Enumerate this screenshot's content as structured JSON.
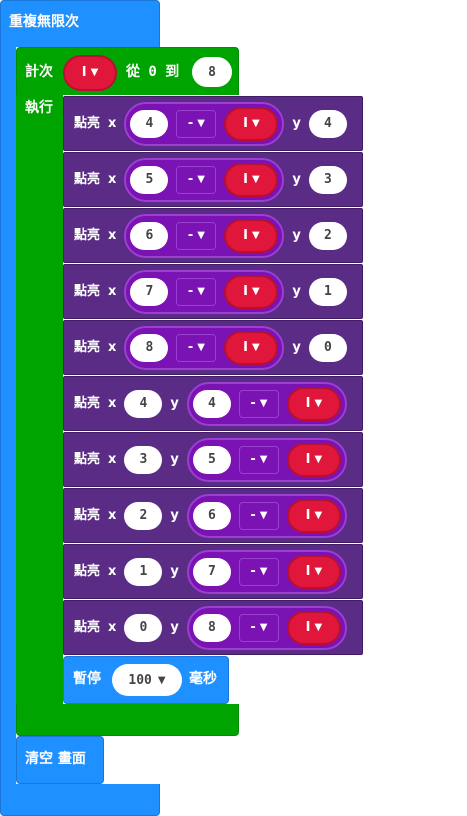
{
  "forever": {
    "label": "重複無限次"
  },
  "for_loop": {
    "label": "計次",
    "var": "I",
    "from_to": "從 0 到",
    "end_value": "8",
    "do_label": "執行"
  },
  "plot_label": "點亮",
  "x_label": "x",
  "y_label": "y",
  "minus_op": "-",
  "plot_rows": [
    {
      "x": "4",
      "y": "4"
    },
    {
      "x": "5",
      "y": "3"
    },
    {
      "x": "6",
      "y": "2"
    },
    {
      "x": "7",
      "y": "1"
    },
    {
      "x": "8",
      "y": "0"
    }
  ],
  "plot_rows2": [
    {
      "x": "4",
      "y": "4"
    },
    {
      "x": "3",
      "y": "5"
    },
    {
      "x": "2",
      "y": "6"
    },
    {
      "x": "1",
      "y": "7"
    },
    {
      "x": "0",
      "y": "8"
    }
  ],
  "pause": {
    "label": "暫停",
    "value": "100",
    "unit": "毫秒"
  },
  "clear": {
    "label": "清空 畫面"
  },
  "colors": {
    "blue": "#1e90ff",
    "green": "#00a400",
    "purple": "#5b2c86",
    "var_red": "#e0173b"
  }
}
